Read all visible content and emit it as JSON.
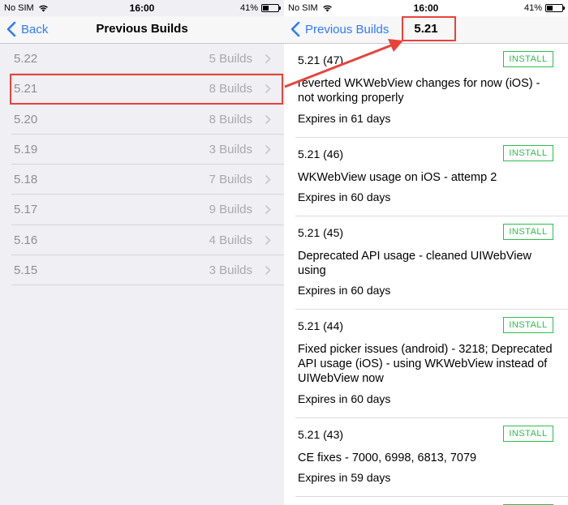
{
  "left": {
    "status": {
      "carrier": "No SIM",
      "time": "16:00",
      "battery": "41%",
      "battery_level": 0.41
    },
    "nav": {
      "back_label": "Back",
      "title": "Previous Builds"
    },
    "versions": [
      {
        "version": "5.22",
        "builds": "5 Builds"
      },
      {
        "version": "5.21",
        "builds": "8 Builds"
      },
      {
        "version": "5.20",
        "builds": "8 Builds"
      },
      {
        "version": "5.19",
        "builds": "3 Builds"
      },
      {
        "version": "5.18",
        "builds": "7 Builds"
      },
      {
        "version": "5.17",
        "builds": "9 Builds"
      },
      {
        "version": "5.16",
        "builds": "4 Builds"
      },
      {
        "version": "5.15",
        "builds": "3 Builds"
      }
    ]
  },
  "right": {
    "status": {
      "carrier": "No SIM",
      "time": "16:00",
      "battery": "41%",
      "battery_level": 0.41
    },
    "nav": {
      "back_label": "Previous Builds",
      "title": "5.21"
    },
    "install_label": "INSTALL",
    "builds": [
      {
        "number": "5.21 (47)",
        "notes": "reverted WKWebView changes for now (iOS) - not working properly",
        "expires": "Expires in 61 days"
      },
      {
        "number": "5.21 (46)",
        "notes": "WKWebView usage on iOS - attemp 2",
        "expires": "Expires in 60 days"
      },
      {
        "number": "5.21 (45)",
        "notes": "Deprecated API usage -  cleaned UIWebView using",
        "expires": "Expires in 60 days"
      },
      {
        "number": "5.21 (44)",
        "notes": "Fixed picker issues (android) - 3218; Deprecated API usage (iOS) - using WKWebView instead of UIWebView now",
        "expires": "Expires in 60 days"
      },
      {
        "number": "5.21 (43)",
        "notes": "CE fixes - 7000, 6998, 6813, 7079",
        "expires": "Expires in 59 days"
      }
    ]
  },
  "colors": {
    "accent": "#2f7cf6",
    "install": "#2ebd4e",
    "callout": "#e8433b"
  }
}
